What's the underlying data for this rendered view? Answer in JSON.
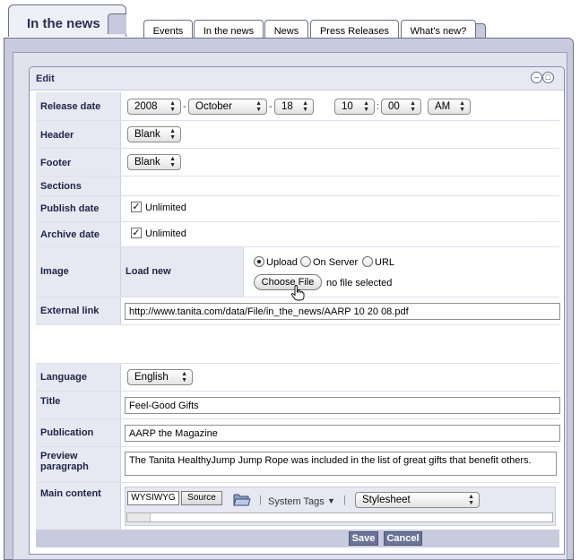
{
  "tabs": {
    "active": "In the news",
    "items": [
      "Events",
      "In the news",
      "News",
      "Press Releases",
      "What's new?"
    ]
  },
  "panel": {
    "title": "Edit",
    "minimize_icon": "minus-circle-icon",
    "restore_icon": "window-restore-icon"
  },
  "form": {
    "release_date": {
      "label": "Release date",
      "year": "2008",
      "month": "October",
      "day": "18",
      "hour": "10",
      "minute": "00",
      "ampm": "AM",
      "date_sep": "-",
      "time_sep": ":"
    },
    "header": {
      "label": "Header",
      "value": "Blank"
    },
    "footer": {
      "label": "Footer",
      "value": "Blank"
    },
    "sections": {
      "label": "Sections"
    },
    "publish_date": {
      "label": "Publish date",
      "checkbox_label": "Unlimited",
      "checked": true
    },
    "archive_date": {
      "label": "Archive date",
      "checkbox_label": "Unlimited",
      "checked": true
    },
    "image": {
      "label": "Image",
      "sublabel": "Load new",
      "options": [
        "Upload",
        "On Server",
        "URL"
      ],
      "selected": "Upload",
      "choose_button": "Choose File",
      "file_status": "no file selected"
    },
    "external_link": {
      "label": "External link",
      "value": "http://www.tanita.com/data/File/in_the_news/AARP 10 20 08.pdf"
    },
    "language": {
      "label": "Language",
      "value": "English"
    },
    "title": {
      "label": "Title",
      "value": "Feel-Good Gifts"
    },
    "publication": {
      "label": "Publication",
      "value": "AARP the Magazine"
    },
    "preview": {
      "label_line1": "Preview",
      "label_line2": "paragraph",
      "value": "The Tanita HealthyJump Jump Rope was included in the list of great gifts that benefit others."
    },
    "main_content": {
      "label": "Main content",
      "mode_wysiwyg": "WYSIWYG",
      "mode_source": "Source",
      "folder_icon": "folder-icon",
      "system_tags": "System Tags",
      "stylesheet": "Stylesheet"
    }
  },
  "actions": {
    "save": "Save",
    "cancel": "Cancel"
  },
  "colors": {
    "accent": "#6b7496",
    "label_bg": "#e6e8f2",
    "frame": "#c8cbdd"
  }
}
